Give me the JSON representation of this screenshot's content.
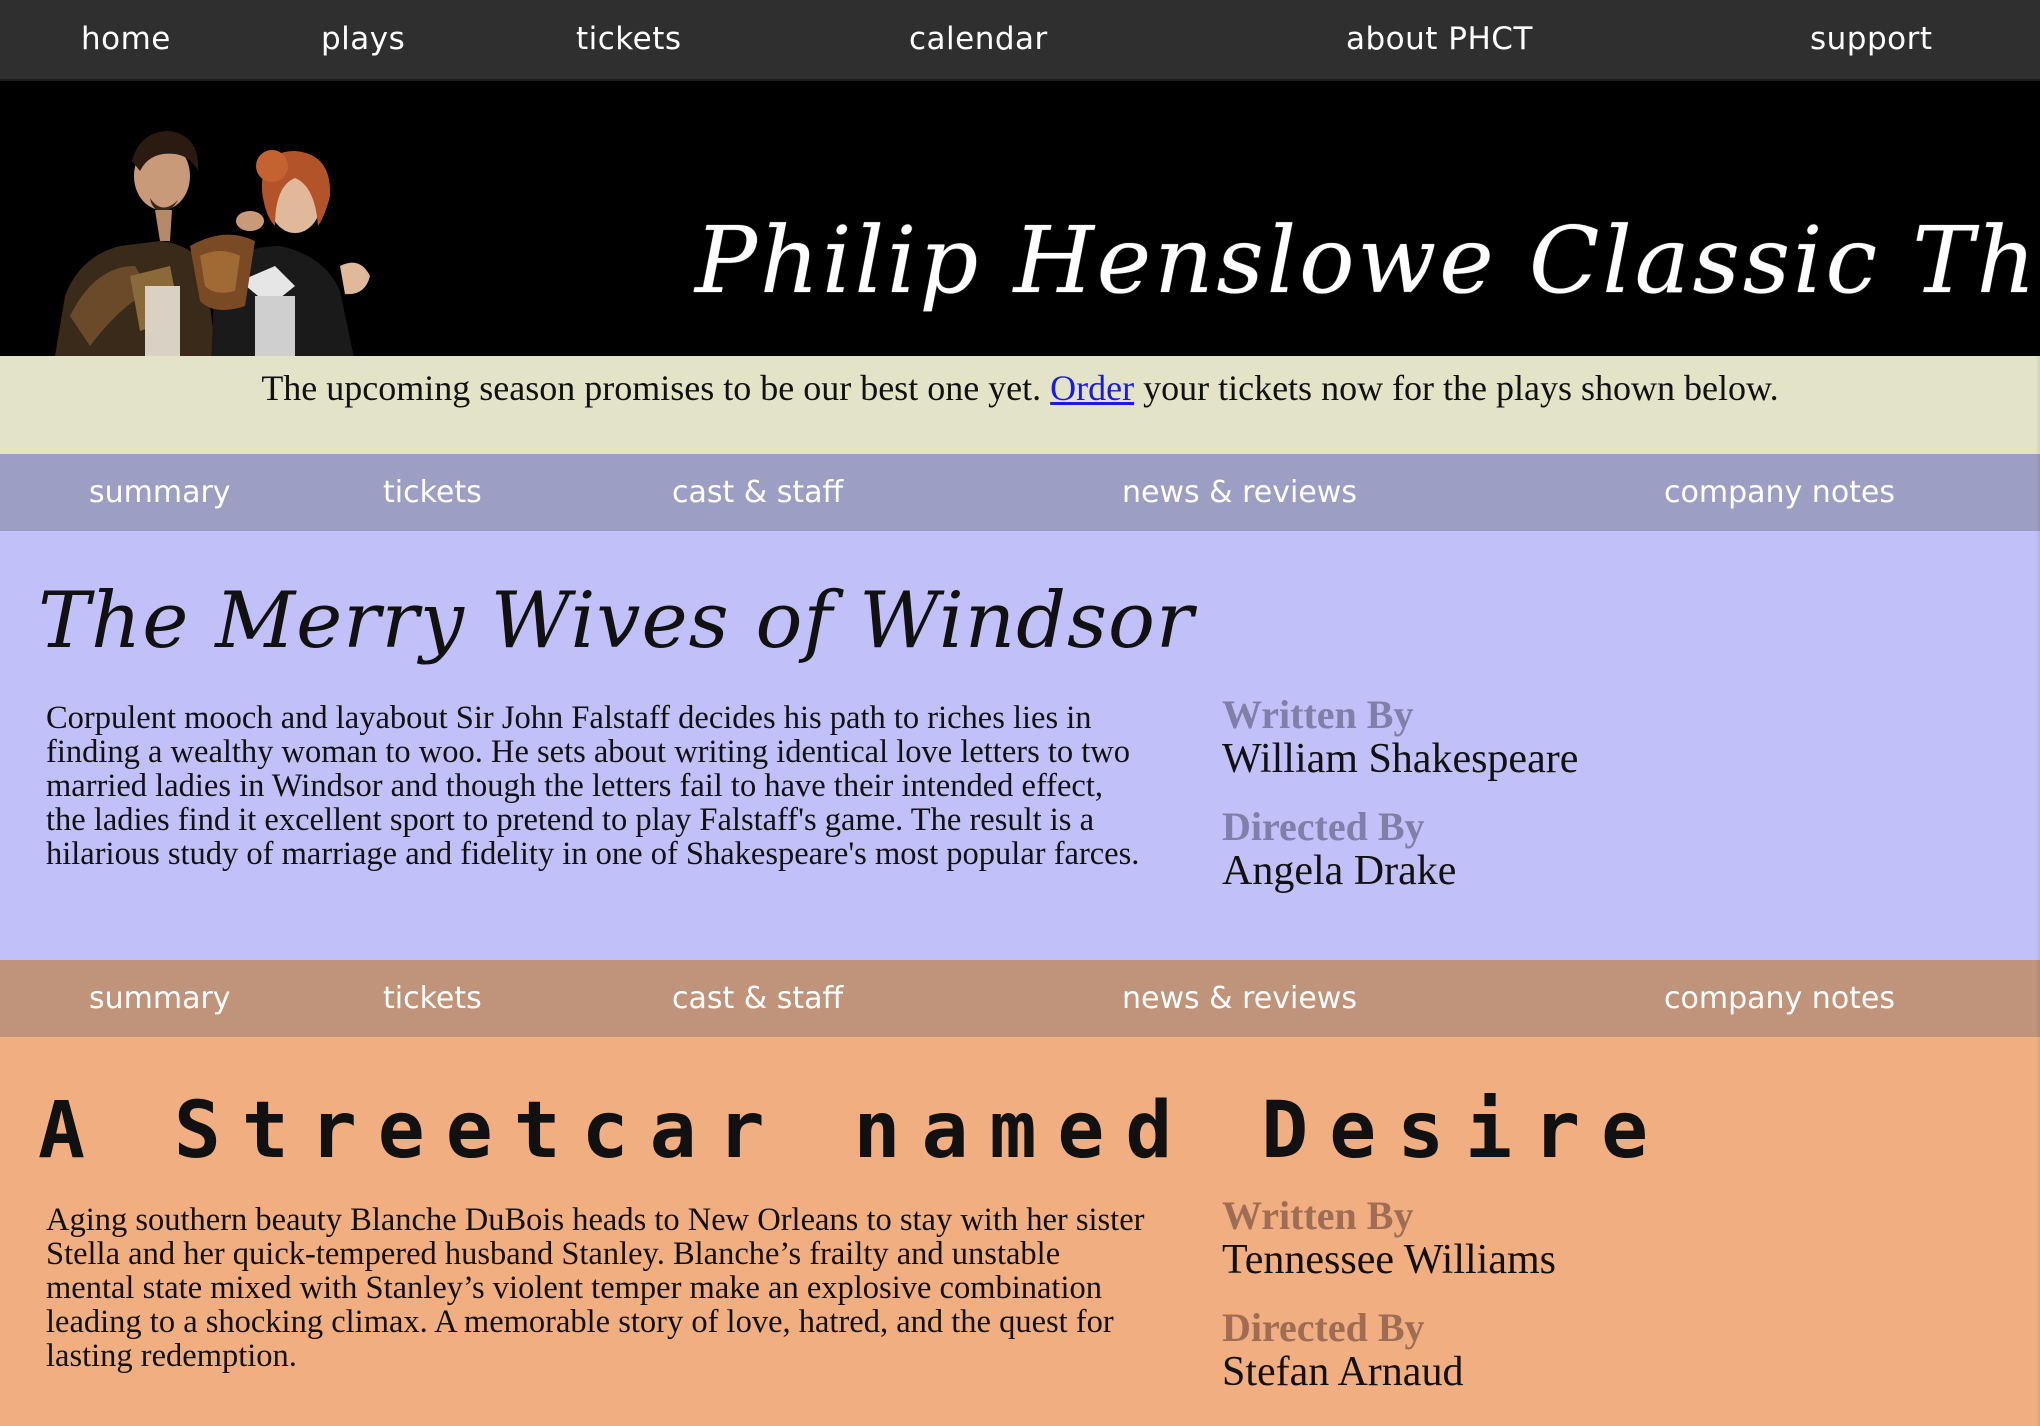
{
  "top_nav": {
    "items": [
      "home",
      "plays",
      "tickets",
      "calendar",
      "about PHCT",
      "support"
    ]
  },
  "banner": {
    "title": "Philip Henslowe Classic Theatre"
  },
  "promo": {
    "before_link": "The upcoming season promises to be our best one yet. ",
    "link": "Order",
    "after_link": " your tickets now for the plays shown below."
  },
  "plays": [
    {
      "nav": [
        "summary",
        "tickets",
        "cast & staff",
        "news & reviews",
        "company notes"
      ],
      "title": "The Merry Wives of Windsor",
      "summary": "Corpulent mooch and layabout Sir John Falstaff decides his path to riches lies in finding a wealthy woman to woo. He sets about writing identical love letters to two married ladies in Windsor and though the letters fail to have their intended effect, the ladies find it excellent sport to pretend to play Falstaff's game. The result is a hilarious study of marriage and fidelity in one of Shakespeare's most popular farces.",
      "written_label": "Written By",
      "writer": "William Shakespeare",
      "directed_label": "Directed By",
      "director": "Angela Drake"
    },
    {
      "nav": [
        "summary",
        "tickets",
        "cast & staff",
        "news & reviews",
        "company notes"
      ],
      "title": "A Streetcar named Desire",
      "summary": "Aging southern beauty Blanche DuBois heads to New Orleans to stay with her sister Stella and her quick-tempered husband Stanley. Blanche’s frailty and unstable mental state mixed with Stanley’s violent temper make an explosive combination leading to a shocking climax. A memorable story of love, hatred, and the quest for lasting redemption.",
      "written_label": "Written By",
      "writer": "Tennessee Williams",
      "directed_label": "Directed By",
      "director": "Stefan Arnaud"
    }
  ],
  "colors": {
    "top_nav_bg": "#2f2f2f",
    "promo_bg": "#e3e3c8",
    "play1_nav_bg": "#9d9ec4",
    "play1_bg": "#c1c0f8",
    "play1_label": "#7f7fa8",
    "play2_nav_bg": "#c0937b",
    "play2_bg": "#f1ae81",
    "play2_label": "#9e6d54",
    "link": "#1a1ae0"
  }
}
